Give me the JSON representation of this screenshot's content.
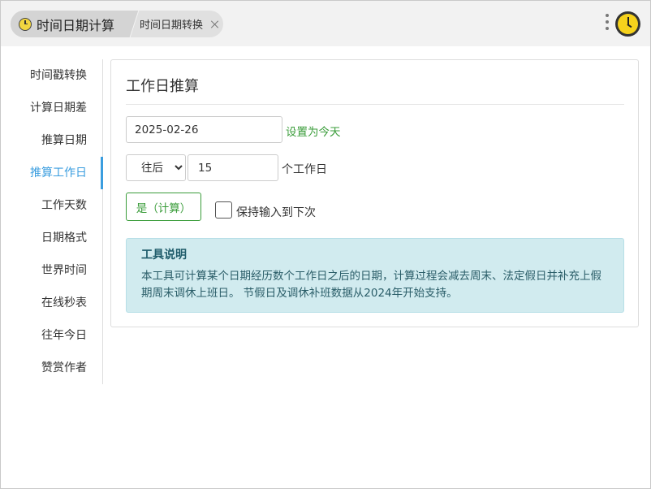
{
  "header": {
    "app_title": "时间日期计算",
    "open_tab": "时间日期转换"
  },
  "sidebar": {
    "items": [
      {
        "label": "时间戳转换",
        "active": false
      },
      {
        "label": "计算日期差",
        "active": false
      },
      {
        "label": "推算日期",
        "active": false
      },
      {
        "label": "推算工作日",
        "active": true
      },
      {
        "label": "工作天数",
        "active": false
      },
      {
        "label": "日期格式",
        "active": false
      },
      {
        "label": "世界时间",
        "active": false
      },
      {
        "label": "在线秒表",
        "active": false
      },
      {
        "label": "往年今日",
        "active": false
      },
      {
        "label": "赞赏作者",
        "active": false
      }
    ]
  },
  "main": {
    "title": "工作日推算",
    "date_value": "2025-02-26",
    "set_today_label": "设置为今天",
    "direction_selected": "往后",
    "days_value": "15",
    "days_unit": "个工作日",
    "calc_button_label": "是（计算）",
    "keep_input_label": "保持输入到下次",
    "keep_input_checked": false,
    "info": {
      "title": "工具说明",
      "text": "本工具可计算某个日期经历数个工作日之后的日期，计算过程会减去周末、法定假日并补充上假期周末调休上班日。 节假日及调休补班数据从2024年开始支持。"
    }
  },
  "colors": {
    "accent_blue": "#3a9ddf",
    "accent_green": "#3a9c3a",
    "info_bg": "#d1ebef",
    "clock_yellow": "#f6d21c"
  },
  "icons": {
    "app_icon": "clock-icon",
    "close_tab": "close-icon",
    "menu": "more-vertical-icon",
    "app_logo": "clock-icon"
  }
}
